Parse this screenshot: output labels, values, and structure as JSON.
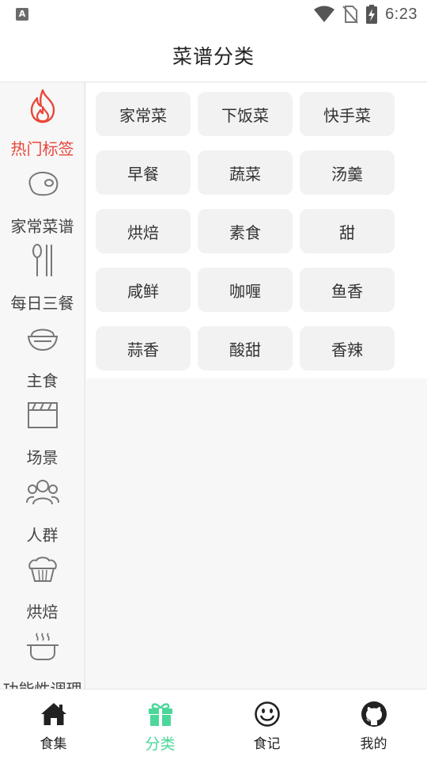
{
  "status_bar": {
    "time": "6:23",
    "notif_glyph": "A"
  },
  "header": {
    "title": "菜谱分类"
  },
  "sidebar": {
    "items": [
      {
        "label": "热门标签",
        "icon": "fire-icon",
        "active": true
      },
      {
        "label": "家常菜谱",
        "icon": "meat-icon",
        "active": false
      },
      {
        "label": "每日三餐",
        "icon": "spoon-fork-icon",
        "active": false
      },
      {
        "label": "主食",
        "icon": "rice-bowl-icon",
        "active": false
      },
      {
        "label": "场景",
        "icon": "clapperboard-icon",
        "active": false
      },
      {
        "label": "人群",
        "icon": "people-icon",
        "active": false
      },
      {
        "label": "烘焙",
        "icon": "muffin-icon",
        "active": false
      },
      {
        "label": "功能性调理",
        "icon": "steaming-pot-icon",
        "active": false
      }
    ]
  },
  "tags": [
    "家常菜",
    "下饭菜",
    "快手菜",
    "早餐",
    "蔬菜",
    "汤羹",
    "烘焙",
    "素食",
    "甜",
    "咸鲜",
    "咖喱",
    "鱼香",
    "蒜香",
    "酸甜",
    "香辣"
  ],
  "bottom_nav": {
    "items": [
      {
        "label": "食集",
        "icon": "home-icon",
        "active": false
      },
      {
        "label": "分类",
        "icon": "gift-icon",
        "active": true
      },
      {
        "label": "食记",
        "icon": "smiley-icon",
        "active": false
      },
      {
        "label": "我的",
        "icon": "github-icon",
        "active": false
      }
    ]
  },
  "colors": {
    "accent_red": "#e8473b",
    "accent_green": "#4cd79a",
    "tag_bg": "#f2f2f2",
    "sidebar_bg": "#f7f7f7"
  }
}
